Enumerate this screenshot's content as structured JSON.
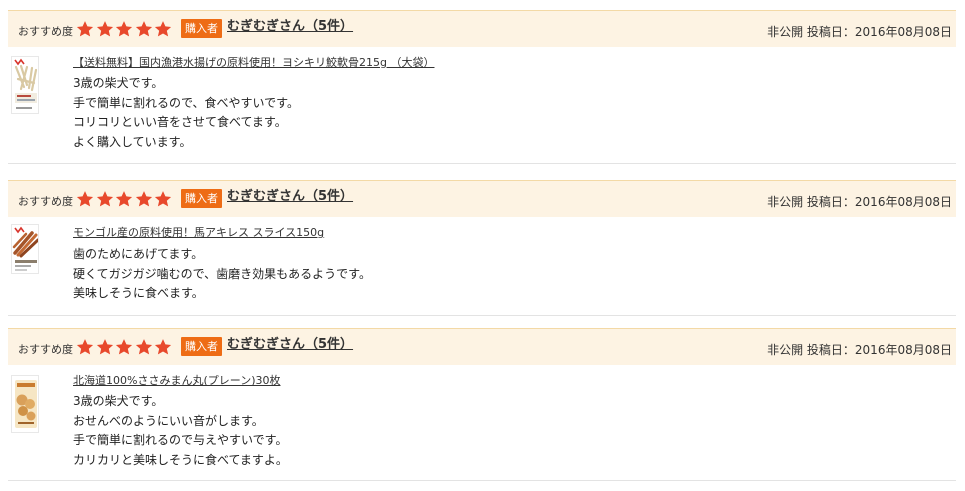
{
  "colors": {
    "header_bg": "#fdf3e3",
    "header_border": "#f3d9a6",
    "star": "#e8492c",
    "badge": "#ee6c15"
  },
  "reviews": [
    {
      "recommend_label": "おすすめ度",
      "rating": 5,
      "buyer_badge": "購入者",
      "reviewer": "むぎむぎさん（5件）",
      "post_info": "非公開 投稿日：2016年08月08日",
      "product_icon": "dried-fish-snack-icon",
      "product": "【送料無料】国内漁港水揚げの原料使用！ヨシキリ鮫軟骨215g （大袋）",
      "body": [
        "3歳の柴犬です。",
        "手で簡単に割れるので、食べやすいです。",
        "コリコリといい音をさせて食べてます。",
        "よく購入しています。"
      ]
    },
    {
      "recommend_label": "おすすめ度",
      "rating": 5,
      "buyer_badge": "購入者",
      "reviewer": "むぎむぎさん（5件）",
      "post_info": "非公開 投稿日：2016年08月08日",
      "product_icon": "horse-tendon-snack-icon",
      "product": "モンゴル産の原料使用！馬アキレス スライス150g",
      "body": [
        "歯のためにあげてます。",
        "硬くてガジガジ噛むので、歯磨き効果もあるようです。",
        "美味しそうに食べます。"
      ]
    },
    {
      "recommend_label": "おすすめ度",
      "rating": 5,
      "buyer_badge": "購入者",
      "reviewer": "むぎむぎさん（5件）",
      "post_info": "非公開 投稿日：2016年08月08日",
      "product_icon": "chicken-chip-snack-icon",
      "product": "北海道100%ささみまん丸(プレーン)30枚",
      "body": [
        "3歳の柴犬です。",
        "おせんべのようにいい音がします。",
        "手で簡単に割れるので与えやすいです。",
        "カリカリと美味しそうに食べてますよ。"
      ]
    }
  ]
}
